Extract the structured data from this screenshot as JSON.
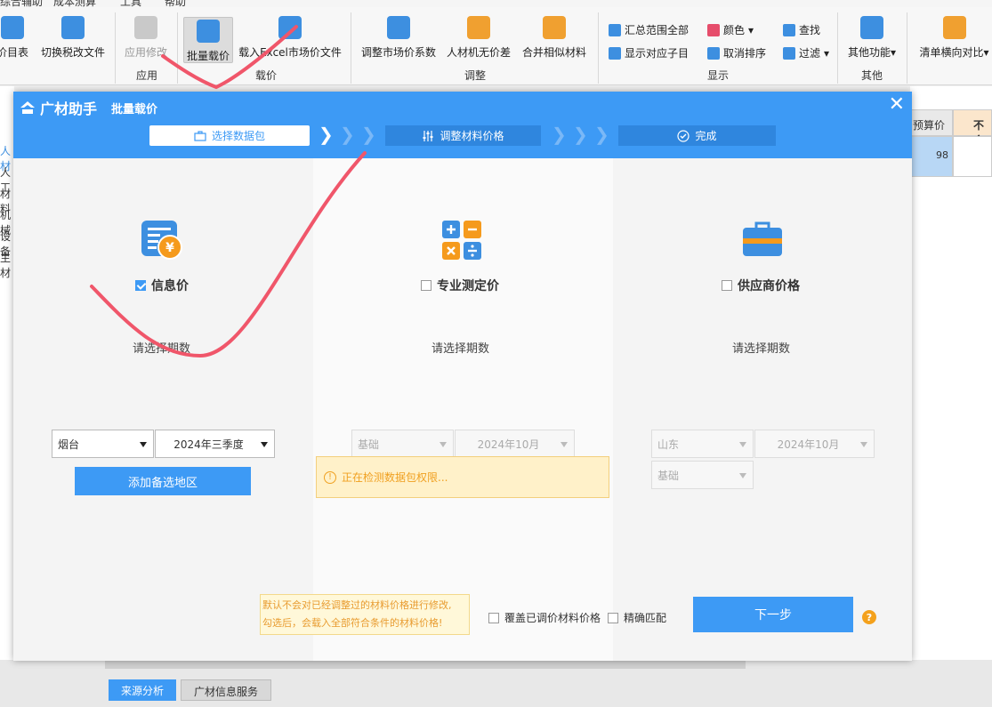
{
  "menubar": {
    "items": [
      "综合辅助",
      "成本测算",
      "工具",
      "帮助"
    ]
  },
  "ribbon": {
    "buttons": {
      "price_catalog": "价目表",
      "switch_tax": "切换税改文件",
      "apply_edit": "应用修改",
      "batch_load": "批量载价",
      "load_excel": "载入Excel市场价文件",
      "adjust_coef": "调整市场价系数",
      "diff": "人材机无价差",
      "merge": "合并相似材料",
      "summary": "汇总范围全部",
      "show_child": "显示对应子目",
      "color": "颜色",
      "cancel_sort": "取消排序",
      "find": "查找",
      "filter": "过滤",
      "other_func": "其他功能",
      "compare": "清单横向对比"
    },
    "groups": {
      "apply": "应用",
      "load": "载价",
      "adjust": "调整",
      "display": "显示",
      "other": "其他"
    }
  },
  "background": {
    "left_labels": [
      "人材",
      "人工",
      "材料",
      "机械",
      "设备",
      "主材"
    ],
    "col_budget": "预算价",
    "col_tax": "不含",
    "cell_value": "98",
    "tabs": [
      "来源分析",
      "广材信息服务"
    ]
  },
  "dialog": {
    "logo": "广材助手",
    "title": "批量载价",
    "steps": [
      "选择数据包",
      "调整材料价格",
      "完成"
    ],
    "col1": {
      "label": "信息价",
      "checked": true,
      "period_label": "请选择期数",
      "region": "烟台",
      "period": "2024年三季度",
      "add_region": "添加备选地区"
    },
    "col2": {
      "label": "专业测定价",
      "checked": false,
      "period_label": "请选择期数",
      "region": "基础",
      "period": "2024年10月",
      "notice": "正在检测数据包权限..."
    },
    "col3": {
      "label": "供应商价格",
      "checked": false,
      "period_label": "请选择期数",
      "region": "山东",
      "period": "2024年10月",
      "type": "基础"
    },
    "tip_line1": "默认不会对已经调整过的材料价格进行修改,",
    "tip_line2": "勾选后，会载入全部符合条件的材料价格!",
    "opt_cover": "覆盖已调价材料价格",
    "opt_exact": "精确匹配",
    "next": "下一步",
    "help": "?"
  },
  "colors": {
    "accent": "#3d9af5",
    "warning": "#f0a020",
    "annotation": "#f0566a"
  }
}
